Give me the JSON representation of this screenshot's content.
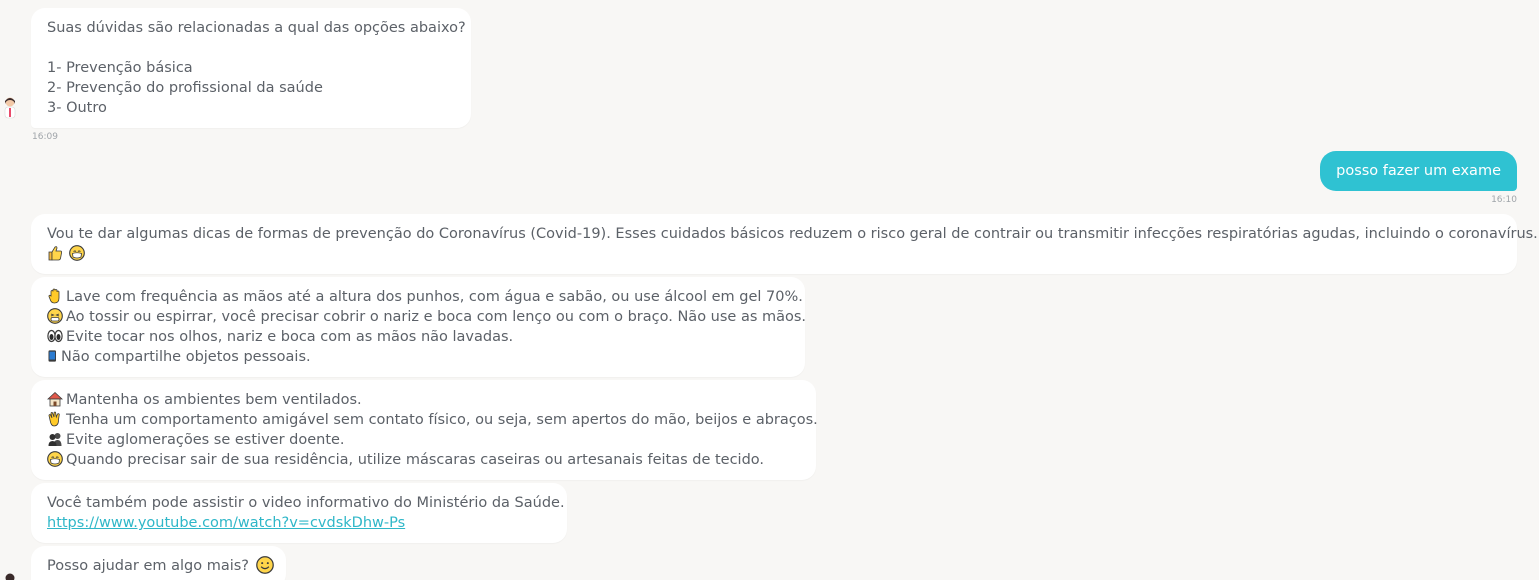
{
  "messages": {
    "m1": {
      "lines": [
        "Suas dúvidas são relacionadas a qual das opções abaixo?",
        "",
        "1- Prevenção básica",
        "2- Prevenção do profissional da saúde",
        "3- Outro"
      ],
      "time": "16:09"
    },
    "user1": {
      "text": "posso fazer um exame",
      "time": "16:10"
    },
    "m2": {
      "text": "Vou te dar algumas dicas de formas de prevenção do Coronavírus (Covid-19). Esses cuidados básicos reduzem o risco geral de contrair ou transmitir infecções respiratórias agudas, incluindo o coronavírus.",
      "emojis": [
        "thumbs-up-emoji",
        "face-with-mask-emoji"
      ]
    },
    "m3": {
      "lines": [
        {
          "icon": "raised-hand-emoji",
          "text": "Lave com frequência as mãos até a altura dos punhos, com água e sabão, ou use álcool em gel 70%."
        },
        {
          "icon": "sneezing-face-emoji",
          "text": "Ao tossir ou espirrar, você precisar cobrir o nariz e boca com lenço ou com o braço. Não use as mãos."
        },
        {
          "icon": "eyes-emoji",
          "text": "Evite tocar nos olhos, nariz e boca com as mãos não lavadas."
        },
        {
          "icon": "mobile-phone-emoji",
          "text": "Não compartilhe objetos pessoais."
        }
      ]
    },
    "m4": {
      "lines": [
        {
          "icon": "house-emoji",
          "text": "Mantenha os ambientes bem ventilados."
        },
        {
          "icon": "waving-hand-emoji",
          "text": "Tenha um comportamento amigável sem contato físico, ou seja, sem apertos do mão, beijos e abraços."
        },
        {
          "icon": "busts-emoji",
          "text": "Evite aglomerações se estiver doente."
        },
        {
          "icon": "face-with-mask-emoji",
          "text": "Quando precisar sair de sua residência, utilize máscaras caseiras ou artesanais feitas de tecido."
        }
      ]
    },
    "m5": {
      "text": "Você também pode assistir o video informativo do Ministério da Saúde.",
      "link": "https://www.youtube.com/watch?v=cvdskDhw-Ps"
    },
    "m6": {
      "text": "Posso ajudar em algo mais?",
      "icon": "smiling-face-emoji"
    }
  },
  "colors": {
    "background": "#f8f7f5",
    "bot_bubble": "#ffffff",
    "user_bubble": "#2fc2d2",
    "link": "#2fb7c8"
  }
}
